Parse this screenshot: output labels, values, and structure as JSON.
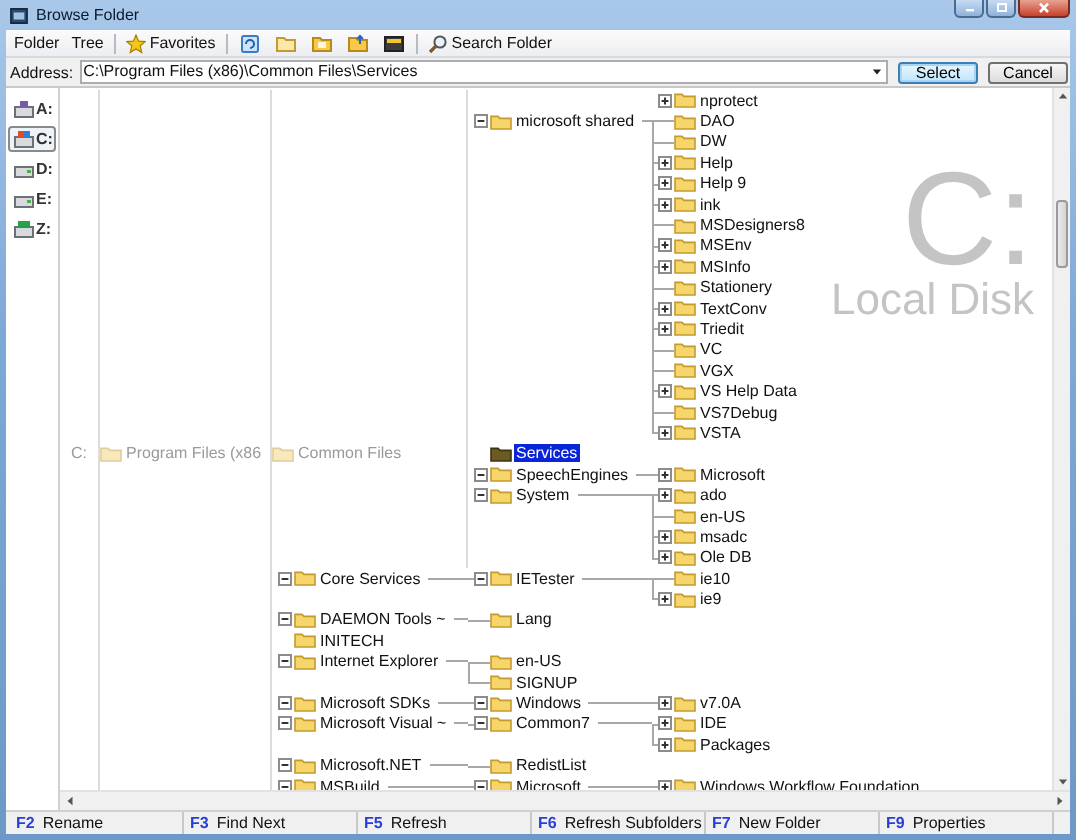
{
  "window": {
    "title": "Browse Folder"
  },
  "toolbar": {
    "menus": [
      "Folder",
      "Tree"
    ],
    "favorites": "Favorites",
    "search": "Search Folder"
  },
  "address": {
    "label": "Address:",
    "value": "C:\\Program Files (x86)\\Common Files\\Services"
  },
  "buttons": [
    {
      "label": "Select",
      "default": true
    },
    {
      "label": "Cancel",
      "default": false
    }
  ],
  "drives": [
    {
      "label": "A:",
      "kind": "floppy",
      "selected": false
    },
    {
      "label": "C:",
      "kind": "system",
      "selected": true
    },
    {
      "label": "D:",
      "kind": "disk",
      "selected": false
    },
    {
      "label": "E:",
      "kind": "disk",
      "selected": false
    },
    {
      "label": "Z:",
      "kind": "network",
      "selected": false
    }
  ],
  "watermark": {
    "letter": "C:",
    "caption": "Local Disk"
  },
  "tree": {
    "label": "C:",
    "kind": "drive",
    "selected": false,
    "children": [
      {
        "label": "Program Files (x86",
        "kind": "path",
        "selected": false,
        "children": [
          {
            "label": "Common Files",
            "kind": "path",
            "selected": false,
            "children": [
              {
                "kind": "offscreen",
                "children": [
                  {
                    "label": "nprotect",
                    "kind": "folder",
                    "expanded": false,
                    "selected": false
                  }
                ]
              },
              {
                "label": "microsoft shared",
                "kind": "folder",
                "expanded": true,
                "selected": false,
                "children": [
                  {
                    "label": "DAO",
                    "kind": "folder",
                    "selected": false
                  },
                  {
                    "label": "DW",
                    "kind": "folder",
                    "selected": false
                  },
                  {
                    "label": "Help",
                    "kind": "folder",
                    "expanded": false,
                    "selected": false
                  },
                  {
                    "label": "Help 9",
                    "kind": "folder",
                    "expanded": false,
                    "selected": false
                  },
                  {
                    "label": "ink",
                    "kind": "folder",
                    "expanded": false,
                    "selected": false
                  },
                  {
                    "label": "MSDesigners8",
                    "kind": "folder",
                    "selected": false
                  },
                  {
                    "label": "MSEnv",
                    "kind": "folder",
                    "expanded": false,
                    "selected": false
                  },
                  {
                    "label": "MSInfo",
                    "kind": "folder",
                    "expanded": false,
                    "selected": false
                  },
                  {
                    "label": "Stationery",
                    "kind": "folder",
                    "selected": false
                  },
                  {
                    "label": "TextConv",
                    "kind": "folder",
                    "expanded": false,
                    "selected": false
                  },
                  {
                    "label": "Triedit",
                    "kind": "folder",
                    "expanded": false,
                    "selected": false
                  },
                  {
                    "label": "VC",
                    "kind": "folder",
                    "selected": false
                  },
                  {
                    "label": "VGX",
                    "kind": "folder",
                    "selected": false
                  },
                  {
                    "label": "VS Help Data",
                    "kind": "folder",
                    "expanded": false,
                    "selected": false
                  },
                  {
                    "label": "VS7Debug",
                    "kind": "folder",
                    "selected": false
                  },
                  {
                    "label": "VSTA",
                    "kind": "folder",
                    "expanded": false,
                    "selected": false
                  }
                ]
              },
              {
                "label": "Services",
                "kind": "folder",
                "selected": true
              },
              {
                "label": "SpeechEngines",
                "kind": "folder",
                "expanded": true,
                "selected": false,
                "children": [
                  {
                    "label": "Microsoft",
                    "kind": "folder",
                    "expanded": false,
                    "selected": false
                  }
                ]
              },
              {
                "label": "System",
                "kind": "folder",
                "expanded": true,
                "selected": false,
                "children": [
                  {
                    "label": "ado",
                    "kind": "folder",
                    "expanded": false,
                    "selected": false
                  },
                  {
                    "label": "en-US",
                    "kind": "folder",
                    "selected": false
                  },
                  {
                    "label": "msadc",
                    "kind": "folder",
                    "expanded": false,
                    "selected": false
                  },
                  {
                    "label": "Ole DB",
                    "kind": "folder",
                    "expanded": false,
                    "selected": false
                  }
                ]
              }
            ]
          },
          {
            "label": "Core Services",
            "kind": "folder",
            "expanded": true,
            "selected": false,
            "children": [
              {
                "label": "IETester",
                "kind": "folder",
                "expanded": true,
                "selected": false,
                "children": [
                  {
                    "label": "ie10",
                    "kind": "folder",
                    "selected": false
                  },
                  {
                    "label": "ie9",
                    "kind": "folder",
                    "expanded": false,
                    "selected": false
                  }
                ]
              }
            ]
          },
          {
            "label": "DAEMON Tools ~",
            "kind": "folder",
            "expanded": true,
            "selected": false,
            "children": [
              {
                "label": "Lang",
                "kind": "folder",
                "selected": false
              }
            ]
          },
          {
            "label": "INITECH",
            "kind": "folder",
            "selected": false
          },
          {
            "label": "Internet Explorer",
            "kind": "folder",
            "expanded": true,
            "selected": false,
            "children": [
              {
                "label": "en-US",
                "kind": "folder",
                "selected": false
              },
              {
                "label": "SIGNUP",
                "kind": "folder",
                "selected": false
              }
            ]
          },
          {
            "label": "Microsoft SDKs",
            "kind": "folder",
            "expanded": true,
            "selected": false,
            "children": [
              {
                "label": "Windows",
                "kind": "folder",
                "expanded": true,
                "selected": false,
                "children": [
                  {
                    "label": "v7.0A",
                    "kind": "folder",
                    "expanded": false,
                    "selected": false
                  }
                ]
              }
            ]
          },
          {
            "label": "Microsoft Visual ~",
            "kind": "folder",
            "expanded": true,
            "selected": false,
            "children": [
              {
                "label": "Common7",
                "kind": "folder",
                "expanded": true,
                "selected": false,
                "children": [
                  {
                    "label": "IDE",
                    "kind": "folder",
                    "expanded": false,
                    "selected": false
                  },
                  {
                    "label": "Packages",
                    "kind": "folder",
                    "expanded": false,
                    "selected": false
                  }
                ]
              }
            ]
          },
          {
            "label": "Microsoft.NET",
            "kind": "folder",
            "expanded": true,
            "selected": false,
            "children": [
              {
                "label": "RedistList",
                "kind": "folder",
                "selected": false
              }
            ]
          },
          {
            "label": "MSBuild",
            "kind": "folder",
            "expanded": true,
            "selected": false,
            "children": [
              {
                "label": "Microsoft",
                "kind": "folder",
                "expanded": true,
                "selected": false,
                "children": [
                  {
                    "label": "Windows Workflow Foundation",
                    "kind": "folder",
                    "expanded": false,
                    "selected": false
                  }
                ]
              }
            ]
          }
        ]
      }
    ]
  },
  "status_bar": [
    {
      "key": "F2",
      "label": "Rename"
    },
    {
      "key": "F3",
      "label": "Find Next"
    },
    {
      "key": "F5",
      "label": "Refresh"
    },
    {
      "key": "F6",
      "label": "Refresh Subfolders"
    },
    {
      "key": "F7",
      "label": "New Folder"
    },
    {
      "key": "F9",
      "label": "Properties"
    }
  ]
}
